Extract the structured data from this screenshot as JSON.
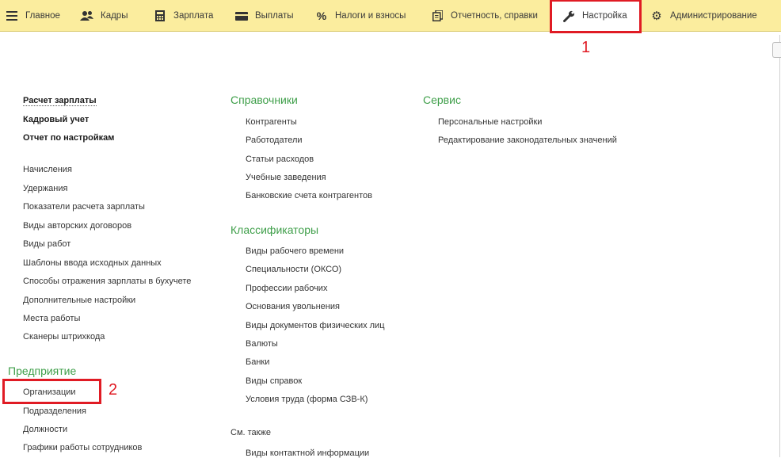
{
  "menu": {
    "items": [
      {
        "label": "Главное",
        "icon": "hamburger-icon"
      },
      {
        "label": "Кадры",
        "icon": "people-icon"
      },
      {
        "label": "Зарплата",
        "icon": "calculator-icon"
      },
      {
        "label": "Выплаты",
        "icon": "wallet-icon"
      },
      {
        "label": "Налоги и взносы",
        "icon": "percent-icon"
      },
      {
        "label": "Отчетность, справки",
        "icon": "documents-icon"
      },
      {
        "label": "Настройка",
        "icon": "wrench-icon"
      },
      {
        "label": "Администрирование",
        "icon": "gear-icon"
      }
    ],
    "active": "Настройка"
  },
  "annotations": {
    "one": "1",
    "two": "2",
    "color": "#e01b24"
  },
  "col1": {
    "bold_items": [
      "Расчет зарплаты",
      "Кадровый учет",
      "Отчет по настройкам"
    ],
    "items": [
      "Начисления",
      "Удержания",
      "Показатели расчета зарплаты",
      "Виды авторских договоров",
      "Виды работ",
      "Шаблоны ввода исходных данных",
      "Способы отражения зарплаты в бухучете",
      "Дополнительные настройки",
      "Места работы",
      "Сканеры штрихкода"
    ],
    "enterprise": {
      "title": "Предприятие",
      "items": [
        "Организации",
        "Подразделения",
        "Должности",
        "Графики работы сотрудников"
      ]
    }
  },
  "col2": {
    "references": {
      "title": "Справочники",
      "items": [
        "Контрагенты",
        "Работодатели",
        "Статьи расходов",
        "Учебные заведения",
        "Банковские счета контрагентов"
      ]
    },
    "classifiers": {
      "title": "Классификаторы",
      "items": [
        "Виды рабочего времени",
        "Специальности (ОКСО)",
        "Профессии рабочих",
        "Основания увольнения",
        "Виды документов физических лиц",
        "Валюты",
        "Банки",
        "Виды справок",
        "Условия труда (форма СЗВ-К)"
      ]
    },
    "see_also": {
      "title": "См. также",
      "items": [
        "Виды контактной информации"
      ]
    }
  },
  "col3": {
    "service": {
      "title": "Сервис",
      "items": [
        "Персональные настройки",
        "Редактирование законодательных значений"
      ]
    }
  },
  "colors": {
    "bar": "#fbed9e",
    "heading_green": "#3f9f4a",
    "annotation_red": "#e01b24"
  }
}
